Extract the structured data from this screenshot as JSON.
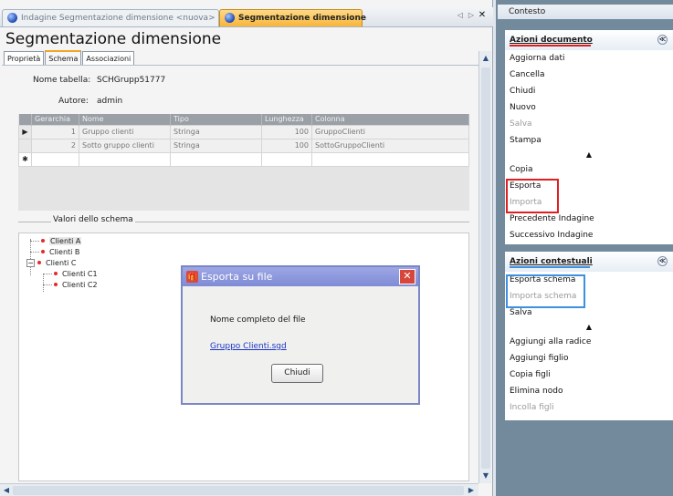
{
  "tabs": [
    {
      "label": "Indagine Segmentazione dimensione <nuova>",
      "active": false
    },
    {
      "label": "Segmentazione dimensione",
      "active": true
    }
  ],
  "tab_nav": {
    "prev": "◁",
    "next": "▷",
    "close": "✕"
  },
  "page_title": "Segmentazione dimensione",
  "subtabs": [
    "Proprietà",
    "Schema",
    "Associazioni"
  ],
  "form": {
    "nome_tabella_label": "Nome tabella:",
    "nome_tabella_value": "SCHGrupp51777",
    "autore_label": "Autore:",
    "autore_value": "admin"
  },
  "grid": {
    "columns": [
      "Gerarchia",
      "Nome",
      "Tipo",
      "Lunghezza",
      "Colonna"
    ],
    "rows": [
      {
        "marker": "▶",
        "gerarchia": "1",
        "nome": "Gruppo clienti",
        "tipo": "Stringa",
        "lunghezza": "100",
        "colonna": "GruppoClienti"
      },
      {
        "marker": "",
        "gerarchia": "2",
        "nome": "Sotto gruppo clienti",
        "tipo": "Stringa",
        "lunghezza": "100",
        "colonna": "SottoGruppoClienti"
      }
    ],
    "new_row_marker": "✱"
  },
  "schema_group": {
    "title": "Valori dello schema",
    "nodes": [
      "Clienti A",
      "Clienti B",
      "Clienti C",
      "Clienti C1",
      "Clienti C2"
    ],
    "expander": "−"
  },
  "dialog": {
    "title": "Esporta su file",
    "label": "Nome completo del file",
    "link": "Gruppo Clienti.sgd",
    "button": "Chiudi",
    "close": "✕",
    "icon": "🎁"
  },
  "context": {
    "title": "Contesto",
    "documento": {
      "header": "Azioni documento",
      "items": [
        {
          "label": "Aggiorna dati",
          "enabled": true
        },
        {
          "label": "Cancella",
          "enabled": true
        },
        {
          "label": "Chiudi",
          "enabled": true
        },
        {
          "label": "Nuovo",
          "enabled": true
        },
        {
          "label": "Salva",
          "enabled": false
        },
        {
          "label": "Stampa",
          "enabled": true
        }
      ],
      "items2": [
        {
          "label": "Copia",
          "enabled": true
        },
        {
          "label": "Esporta",
          "enabled": true
        },
        {
          "label": "Importa",
          "enabled": false
        },
        {
          "label": "Precedente Indagine",
          "enabled": true
        },
        {
          "label": "Successivo Indagine",
          "enabled": true
        }
      ]
    },
    "contestuali": {
      "header": "Azioni contestuali",
      "items": [
        {
          "label": "Esporta schema",
          "enabled": true
        },
        {
          "label": "Importa schema",
          "enabled": false
        },
        {
          "label": "Salva",
          "enabled": true
        }
      ],
      "items2": [
        {
          "label": "Aggiungi alla radice",
          "enabled": true
        },
        {
          "label": "Aggiungi figlio",
          "enabled": true
        },
        {
          "label": "Copia figli",
          "enabled": true
        },
        {
          "label": "Elimina nodo",
          "enabled": true
        },
        {
          "label": "Incolla figli",
          "enabled": false
        }
      ]
    },
    "chevron": "≪",
    "separator": "▲"
  },
  "colors": {
    "accent_orange": "#f7b53b",
    "highlight_red": "#e02020",
    "highlight_blue": "#3f8fe0",
    "panel_underline_documento": "#d61f1f",
    "panel_underline_contestuali": "#3f8fe0"
  },
  "scroll": {
    "up": "▲",
    "down": "▼",
    "left": "◀",
    "right": "▶"
  }
}
